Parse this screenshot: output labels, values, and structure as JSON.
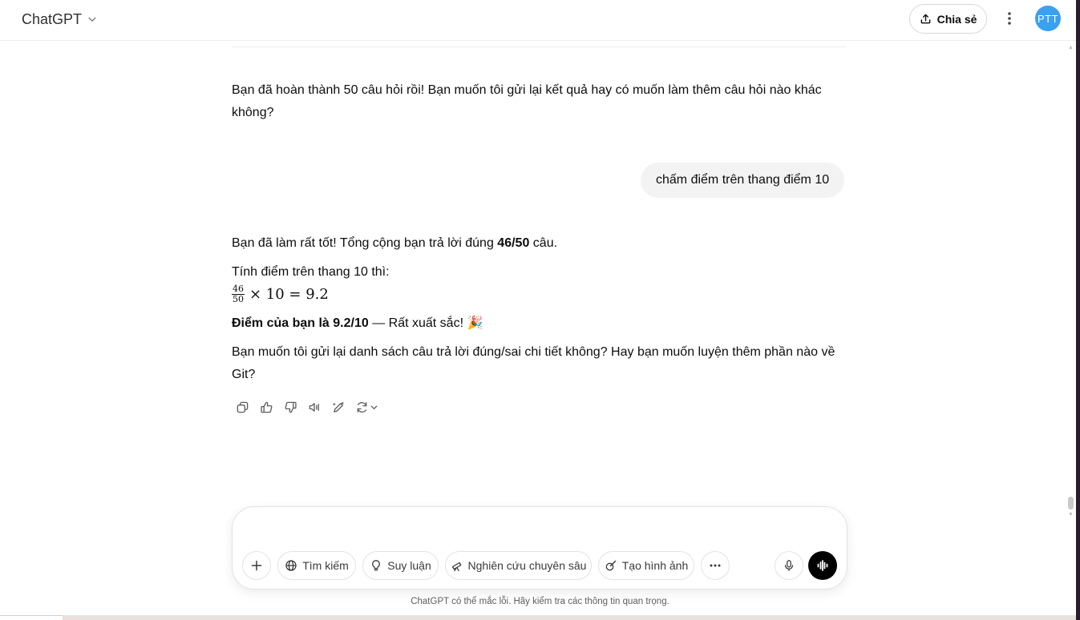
{
  "header": {
    "model_name": "ChatGPT",
    "share_label": "Chia sẻ",
    "avatar_initials": "PTT"
  },
  "conversation": {
    "assistant_prev": "Bạn đã hoàn thành 50 câu hỏi rồi! Bạn muốn tôi gửi lại kết quả hay có muốn làm thêm câu hỏi nào khác không?",
    "user_message": "chấm điểm trên thang điểm 10",
    "assistant_reply": {
      "p1_text": "Bạn đã làm rất tốt! Tổng cộng bạn trả lời đúng ",
      "p1_bold": "46/50",
      "p1_end": " câu.",
      "p2": "Tính điểm trên thang 10 thì:",
      "math": {
        "numerator": "46",
        "denominator": "50",
        "rest": "× 10 = 9.2"
      },
      "p3_bold": "Điểm của bạn là 9.2/10",
      "p3_text": " — Rất xuất sắc! 🎉",
      "p4": "Bạn muốn tôi gửi lại danh sách câu trả lời đúng/sai chi tiết không? Hay bạn muốn luyện thêm phần nào về Git?"
    },
    "action_icons": [
      "copy-icon",
      "thumbs-up-icon",
      "thumbs-down-icon",
      "read-aloud-icon",
      "edit-canvas-icon",
      "regenerate-icon"
    ]
  },
  "composer": {
    "placeholder": "",
    "tools": {
      "search": "Tìm kiếm",
      "reason": "Suy luận",
      "deep_research": "Nghiên cứu chuyên sâu",
      "create_image": "Tạo hình ảnh"
    }
  },
  "footer": {
    "disclaimer": "ChatGPT có thể mắc lỗi. Hãy kiểm tra các thông tin quan trọng."
  },
  "colors": {
    "avatar_bg": "#3aa0f0",
    "user_bubble_bg": "#f3f3f3",
    "voice_button_bg": "#000000"
  }
}
